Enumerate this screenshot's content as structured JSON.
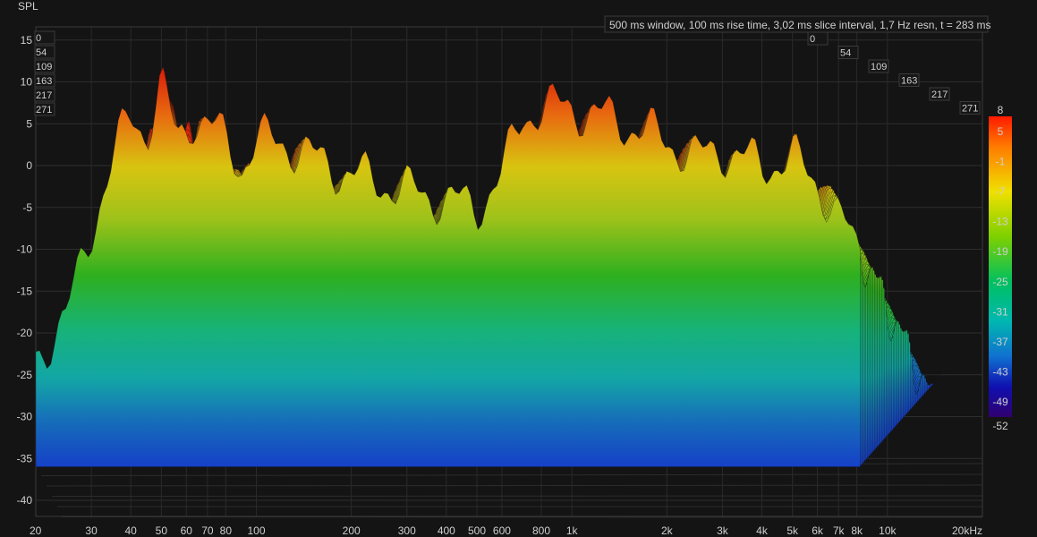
{
  "chart_data": {
    "type": "waterfall",
    "ylabel": "SPL",
    "info": "500 ms window, 100 ms rise time, 3,02 ms slice interval, 1,7 Hz resn, t = 283 ms",
    "yticks": [
      15,
      10,
      5,
      0,
      -5,
      -10,
      -15,
      -20,
      -25,
      -30,
      -35,
      -40
    ],
    "xticks": [
      "20",
      "30",
      "40",
      "50",
      "60",
      "70",
      "80",
      "100",
      "200",
      "300",
      "400",
      "500",
      "600",
      "800",
      "1k",
      "2k",
      "3k",
      "4k",
      "5k",
      "6k",
      "7k",
      "8k",
      "10k",
      "20kHz"
    ],
    "xtick_freqs": [
      20,
      30,
      40,
      50,
      60,
      70,
      80,
      100,
      200,
      300,
      400,
      500,
      600,
      800,
      1000,
      2000,
      3000,
      4000,
      5000,
      6000,
      7000,
      8000,
      10000,
      20000
    ],
    "time_ticks_ms": [
      "0",
      "54",
      "109",
      "163",
      "217",
      "271"
    ],
    "colorbar": {
      "ticks": [
        "8",
        "5",
        "-1",
        "-7",
        "-13",
        "-19",
        "-25",
        "-31",
        "-37",
        "-43",
        "-49",
        "-52"
      ],
      "min": -52,
      "max": 8
    },
    "xlim": [
      20,
      20000
    ],
    "ylim": [
      -42,
      15
    ],
    "grid": true,
    "series": [
      {
        "freqs": [
          20,
          25,
          32,
          36,
          40,
          45,
          50,
          56,
          63,
          70,
          80,
          90,
          100,
          120,
          150,
          200,
          250,
          300,
          400,
          500,
          600,
          700,
          800,
          1000,
          1500,
          2000,
          2500,
          3000,
          4000,
          5000,
          6000,
          7000,
          8000
        ],
        "values": [
          -23,
          -18,
          -4,
          2,
          6,
          4,
          10,
          3,
          6,
          5,
          3,
          0,
          3,
          3,
          1,
          -1,
          -2,
          -3,
          -4,
          -5,
          -1,
          6,
          7,
          7,
          5,
          3,
          1,
          2,
          0,
          1,
          -2,
          -6,
          -10
        ]
      }
    ]
  }
}
